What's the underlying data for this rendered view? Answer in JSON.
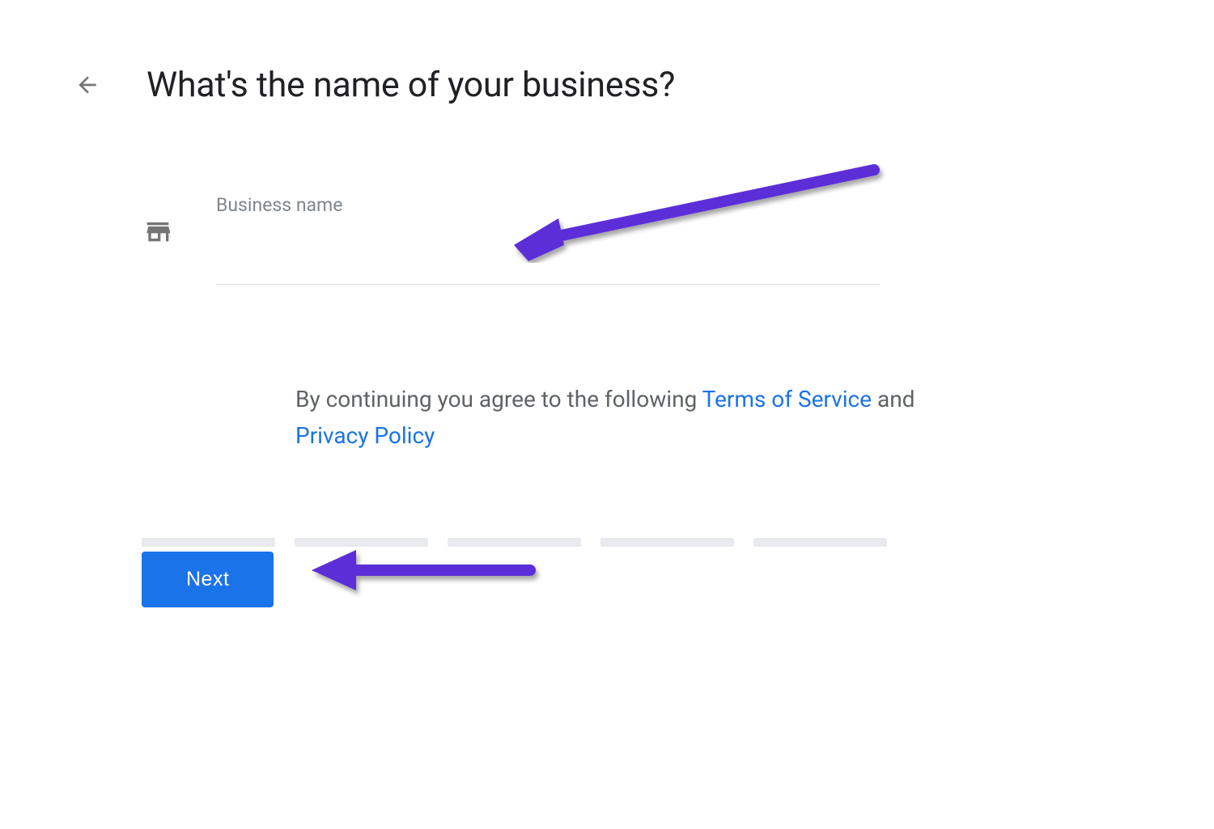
{
  "header": {
    "title": "What's the name of your business?"
  },
  "form": {
    "business_name_label": "Business name",
    "business_name_value": ""
  },
  "terms": {
    "prefix": "By continuing you agree to the following ",
    "tos_link": "Terms of Service",
    "connector": " and ",
    "privacy_link": "Privacy Policy"
  },
  "actions": {
    "next_label": "Next"
  },
  "progress": {
    "segments": 5
  },
  "colors": {
    "primary_blue": "#1a73e8",
    "annotation_purple": "#5b2fd8",
    "text_gray": "#5f6368",
    "light_gray": "#e8eaed"
  }
}
